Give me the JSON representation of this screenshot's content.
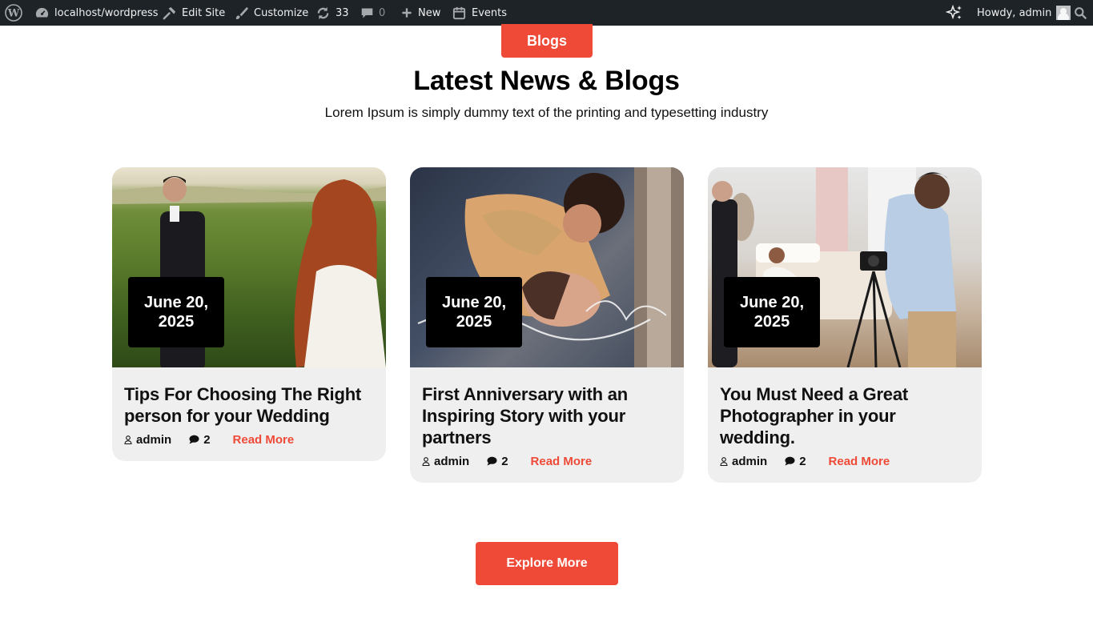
{
  "admin_bar": {
    "site": "localhost/wordpress",
    "edit_site": "Edit Site",
    "customize": "Customize",
    "updates": "33",
    "comments": "0",
    "new": "New",
    "events": "Events",
    "howdy": "Howdy, admin",
    "icons": [
      "wordpress-icon",
      "dashboard-icon",
      "hammer-icon",
      "brush-icon",
      "refresh-icon",
      "comment-icon",
      "plus-icon",
      "calendar-icon",
      "sparkle-icon",
      "search-icon"
    ]
  },
  "section": {
    "pill": "Blogs",
    "title": "Latest News & Blogs",
    "subtitle": "Lorem Ipsum is simply dummy text of the printing and typesetting industry"
  },
  "cards": [
    {
      "date": "June 20, 2025",
      "title": "Tips For Choosing The Right person for your Wedding",
      "author": "admin",
      "comments": "2",
      "read_more": "Read More"
    },
    {
      "date": "June 20, 2025",
      "title": "First Anniversary with an Inspiring Story with your partners",
      "author": "admin",
      "comments": "2",
      "read_more": "Read More"
    },
    {
      "date": "June 20, 2025",
      "title": "You Must Need a Great Photographer in your wedding.",
      "author": "admin",
      "comments": "2",
      "read_more": "Read More"
    }
  ],
  "explore": "Explore More",
  "colors": {
    "accent": "#ef4a37",
    "admin_bar": "#1d2327",
    "card_bg": "#efefef"
  }
}
